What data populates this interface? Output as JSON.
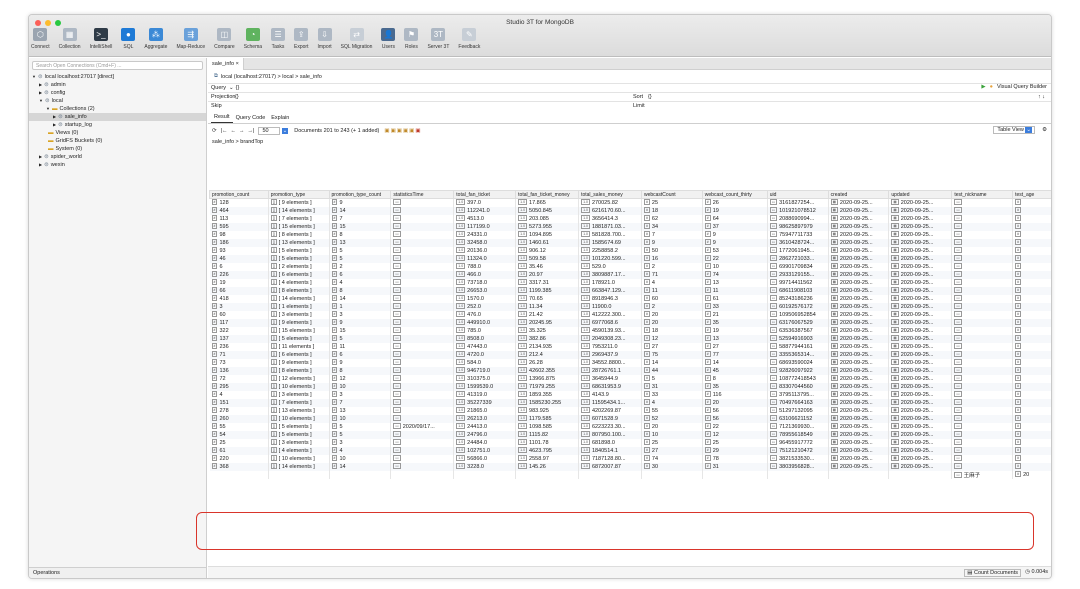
{
  "app": {
    "window_title": "Studio 3T for MongoDB",
    "toolbar": [
      {
        "label": "Connect",
        "icon": "connect-icon",
        "color": "#9aa4b0"
      },
      {
        "label": "Collection",
        "icon": "collection-icon",
        "color": "#aeb8c4"
      },
      {
        "label": "IntelliShell",
        "icon": "intellishell-icon",
        "color": "#2f3b47"
      },
      {
        "label": "SQL",
        "icon": "sql-icon",
        "color": "#1e7ad6"
      },
      {
        "label": "Aggregate",
        "icon": "aggregate-icon",
        "color": "#3b89d6"
      },
      {
        "label": "Map-Reduce",
        "icon": "map-reduce-icon",
        "color": "#6aa1da"
      },
      {
        "label": "Compare",
        "icon": "compare-icon",
        "color": "#aeb8c4"
      },
      {
        "label": "Schema",
        "icon": "schema-icon",
        "color": "#5fb35f"
      },
      {
        "label": "Tasks",
        "icon": "tasks-icon",
        "color": "#aeb8c4"
      },
      {
        "label": "Export",
        "icon": "export-icon",
        "color": "#aeb8c4"
      },
      {
        "label": "Import",
        "icon": "import-icon",
        "color": "#aeb8c4"
      },
      {
        "label": "SQL Migration",
        "icon": "sql-migration-icon",
        "color": "#c7ced6"
      },
      {
        "label": "Users",
        "icon": "users-icon",
        "color": "#4a6a90"
      },
      {
        "label": "Roles",
        "icon": "roles-icon",
        "color": "#aeb8c4"
      },
      {
        "label": "Server 3T",
        "icon": "server-icon",
        "color": "#aeb8c4"
      },
      {
        "label": "Feedback",
        "icon": "feedback-icon",
        "color": "#c7ced6"
      }
    ]
  },
  "sidebar": {
    "search_placeholder": "Search Open Connections (Cmd+F) ...",
    "tree": [
      {
        "label": "local localhost:27017 [direct]",
        "indent": 0,
        "arrow": "▼",
        "sel": false
      },
      {
        "label": "admin",
        "indent": 1,
        "arrow": "▶",
        "sel": false
      },
      {
        "label": "config",
        "indent": 1,
        "arrow": "▶",
        "sel": false
      },
      {
        "label": "local",
        "indent": 1,
        "arrow": "▼",
        "sel": false
      },
      {
        "label": "Collections (2)",
        "indent": 2,
        "arrow": "▼",
        "sel": false
      },
      {
        "label": "sale_info",
        "indent": 3,
        "arrow": "▶",
        "sel": true
      },
      {
        "label": "startup_log",
        "indent": 3,
        "arrow": "▶",
        "sel": false
      },
      {
        "label": "Views (0)",
        "indent": 2,
        "arrow": "",
        "sel": false
      },
      {
        "label": "GridFS Buckets (0)",
        "indent": 2,
        "arrow": "",
        "sel": false
      },
      {
        "label": "System (0)",
        "indent": 2,
        "arrow": "",
        "sel": false
      },
      {
        "label": "spider_world",
        "indent": 1,
        "arrow": "▶",
        "sel": false
      },
      {
        "label": "wexin",
        "indent": 1,
        "arrow": "▶",
        "sel": false
      }
    ],
    "operations_label": "Operations"
  },
  "editor": {
    "tab_label": "sale_info",
    "path": "local (localhost:27017)  >  local  >  sale_info",
    "query_label": "Query",
    "query_value": "{}",
    "projection_label": "Projection",
    "projection_value": "{}",
    "sort_label": "Sort",
    "sort_value": "{}",
    "skip_label": "Skip",
    "limit_label": "Limit",
    "visual_query_builder": "Visual Query Builder",
    "subtabs": [
      "Result",
      "Query Code",
      "Explain"
    ],
    "page_size": "50",
    "documents_info": "Documents 201 to 243 (+ 1 added)",
    "view_mode": "Table View",
    "breadcrumb": "sale_info > brandTop"
  },
  "grid": {
    "columns": [
      "promotion_count",
      "promotion_type",
      "promotion_type_count",
      "statisticsTime",
      "total_fan_ticket",
      "total_fan_ticket_money",
      "total_sales_money",
      "webcastCount",
      "webcast_count_thirty",
      "uid",
      "created",
      "updated",
      "test_nickname",
      "test_age"
    ],
    "rows": [
      [
        "128",
        "[ 9 elements ]",
        "9",
        "",
        "397.0",
        "17.865",
        "270025.82",
        "25",
        "26",
        "3161827254...",
        "2020-09-25...",
        "2020-09-25...",
        "",
        ""
      ],
      [
        "464",
        "[ 14 elements ]",
        "14",
        "",
        "112241.0",
        "5050.845",
        "6216170.60...",
        "18",
        "19",
        "101921078512",
        "2020-09-25...",
        "2020-09-25...",
        "",
        ""
      ],
      [
        "113",
        "[ 7 elements ]",
        "7",
        "",
        "4513.0",
        "203.085",
        "3656414.3",
        "62",
        "64",
        "2088690994...",
        "2020-09-25...",
        "2020-09-25...",
        "",
        ""
      ],
      [
        "595",
        "[ 15 elements ]",
        "15",
        "",
        "117199.0",
        "5273.955",
        "1881871.03...",
        "34",
        "37",
        "98625897979",
        "2020-09-25...",
        "2020-09-25...",
        "",
        ""
      ],
      [
        "98",
        "[ 8 elements ]",
        "8",
        "",
        "24331.0",
        "1094.895",
        "581828.700...",
        "7",
        "9",
        "75947711733",
        "2020-09-25...",
        "2020-09-25...",
        "",
        ""
      ],
      [
        "186",
        "[ 13 elements ]",
        "13",
        "",
        "32458.0",
        "1460.61",
        "1585674.69",
        "9",
        "9",
        "3610428724...",
        "2020-09-25...",
        "2020-09-25...",
        "",
        ""
      ],
      [
        "93",
        "[ 5 elements ]",
        "5",
        "",
        "20136.0",
        "906.12",
        "2258858.2",
        "50",
        "53",
        "1772061945...",
        "2020-09-25...",
        "2020-09-25...",
        "",
        ""
      ],
      [
        "46",
        "[ 5 elements ]",
        "5",
        "",
        "11324.0",
        "509.58",
        "101220.599...",
        "16",
        "22",
        "2862721033...",
        "2020-09-25...",
        "2020-09-25...",
        "",
        ""
      ],
      [
        "6",
        "[ 2 elements ]",
        "2",
        "",
        "788.0",
        "35.46",
        "529.0",
        "2",
        "10",
        "69901709834",
        "2020-09-25...",
        "2020-09-25...",
        "",
        ""
      ],
      [
        "226",
        "[ 6 elements ]",
        "6",
        "",
        "466.0",
        "20.97",
        "3809887.17...",
        "71",
        "74",
        "2933129155...",
        "2020-09-25...",
        "2020-09-25...",
        "",
        ""
      ],
      [
        "19",
        "[ 4 elements ]",
        "4",
        "",
        "73718.0",
        "3317.31",
        "178921.0",
        "4",
        "13",
        "99714411562",
        "2020-09-25...",
        "2020-09-25...",
        "",
        ""
      ],
      [
        "66",
        "[ 8 elements ]",
        "8",
        "",
        "26653.0",
        "1199.385",
        "663847.129...",
        "11",
        "11",
        "68611908103",
        "2020-09-25...",
        "2020-09-25...",
        "",
        ""
      ],
      [
        "418",
        "[ 14 elements ]",
        "14",
        "",
        "1570.0",
        "70.65",
        "8918946.3",
        "60",
        "61",
        "85243186236",
        "2020-09-25...",
        "2020-09-25...",
        "",
        ""
      ],
      [
        "3",
        "[ 1 elements ]",
        "1",
        "",
        "252.0",
        "11.34",
        "11900.0",
        "2",
        "33",
        "60192576172",
        "2020-09-25...",
        "2020-09-25...",
        "",
        ""
      ],
      [
        "60",
        "[ 3 elements ]",
        "3",
        "",
        "476.0",
        "21.42",
        "412222.300...",
        "20",
        "21",
        "109506952854",
        "2020-09-25...",
        "2020-09-25...",
        "",
        ""
      ],
      [
        "117",
        "[ 9 elements ]",
        "9",
        "",
        "449910.0",
        "20245.95",
        "6977068.6",
        "20",
        "35",
        "63176067529",
        "2020-09-25...",
        "2020-09-25...",
        "",
        ""
      ],
      [
        "322",
        "[ 15 elements ]",
        "15",
        "",
        "785.0",
        "35.325",
        "4590139.93...",
        "18",
        "19",
        "63536387567",
        "2020-09-25...",
        "2020-09-25...",
        "",
        ""
      ],
      [
        "137",
        "[ 5 elements ]",
        "5",
        "",
        "8508.0",
        "382.86",
        "2049308.23...",
        "12",
        "13",
        "52594916903",
        "2020-09-25...",
        "2020-09-25...",
        "",
        ""
      ],
      [
        "236",
        "[ 11 elements ]",
        "11",
        "",
        "47443.0",
        "2134.935",
        "7953211.0",
        "27",
        "27",
        "58877944161",
        "2020-09-25...",
        "2020-09-25...",
        "",
        ""
      ],
      [
        "71",
        "[ 6 elements ]",
        "6",
        "",
        "4720.0",
        "212.4",
        "2969437.9",
        "75",
        "77",
        "3355365314...",
        "2020-09-25...",
        "2020-09-25...",
        "",
        ""
      ],
      [
        "73",
        "[ 9 elements ]",
        "9",
        "",
        "584.0",
        "26.28",
        "34552.8800...",
        "14",
        "14",
        "68693590024",
        "2020-09-25...",
        "2020-09-25...",
        "",
        ""
      ],
      [
        "136",
        "[ 8 elements ]",
        "8",
        "",
        "946719.0",
        "42602.355",
        "28726761.1",
        "44",
        "45",
        "92826097922",
        "2020-09-25...",
        "2020-09-25...",
        "",
        ""
      ],
      [
        "72",
        "[ 12 elements ]",
        "12",
        "",
        "310375.0",
        "13966.875",
        "3645944.9",
        "5",
        "8",
        "108772418543",
        "2020-09-25...",
        "2020-09-25...",
        "",
        ""
      ],
      [
        "295",
        "[ 10 elements ]",
        "10",
        "",
        "1599539.0",
        "71979.255",
        "68631953.9",
        "31",
        "35",
        "83307044560",
        "2020-09-25...",
        "2020-09-25...",
        "",
        ""
      ],
      [
        "4",
        "[ 3 elements ]",
        "3",
        "",
        "41319.0",
        "1859.355",
        "4143.9",
        "33",
        "116",
        "3795113795...",
        "2020-09-25...",
        "2020-09-25...",
        "",
        ""
      ],
      [
        "151",
        "[ 7 elements ]",
        "7",
        "",
        "35227339",
        "1585230.255",
        "11595434.1...",
        "4",
        "20",
        "70497664163",
        "2020-09-25...",
        "2020-09-25...",
        "",
        ""
      ],
      [
        "278",
        "[ 13 elements ]",
        "13",
        "",
        "21865.0",
        "983.925",
        "4202269.87",
        "55",
        "56",
        "51297132095",
        "2020-09-25...",
        "2020-09-25...",
        "",
        ""
      ],
      [
        "260",
        "[ 10 elements ]",
        "10",
        "",
        "26213.0",
        "1179.585",
        "6071528.9",
        "52",
        "56",
        "63106621152",
        "2020-09-25...",
        "2020-09-25...",
        "",
        ""
      ],
      [
        "55",
        "[ 5 elements ]",
        "5",
        "2020/09/17...",
        "24413.0",
        "1098.585",
        "6223223.30...",
        "20",
        "22",
        "7121369930...",
        "2020-09-25...",
        "2020-09-25...",
        "",
        ""
      ],
      [
        "54",
        "[ 5 elements ]",
        "5",
        "",
        "24796.0",
        "1115.82",
        "807950.100...",
        "10",
        "12",
        "78955618549",
        "2020-09-25...",
        "2020-09-25...",
        "",
        ""
      ],
      [
        "25",
        "[ 3 elements ]",
        "3",
        "",
        "24484.0",
        "1101.78",
        "681898.0",
        "25",
        "25",
        "96455917772",
        "2020-09-25...",
        "2020-09-25...",
        "",
        ""
      ],
      [
        "61",
        "[ 4 elements ]",
        "4",
        "",
        "102751.0",
        "4623.795",
        "1840514.1",
        "27",
        "29",
        "75121210472",
        "2020-09-25...",
        "2020-09-25...",
        "",
        ""
      ],
      [
        "220",
        "[ 10 elements ]",
        "10",
        "",
        "56866.0",
        "2558.97",
        "7187128.80...",
        "74",
        "78",
        "3821533530...",
        "2020-09-25...",
        "2020-09-25...",
        "",
        ""
      ],
      [
        "368",
        "[ 14 elements ]",
        "14",
        "",
        "3228.0",
        "145.26",
        "6872007.87",
        "30",
        "31",
        "3803956828...",
        "2020-09-25...",
        "2020-09-25...",
        "",
        ""
      ],
      [
        "",
        "",
        "",
        "",
        "",
        "",
        "",
        "",
        "",
        "",
        "",
        "",
        "王麻子",
        "20"
      ]
    ]
  },
  "status": {
    "count_documents": "Count Documents",
    "elapsed": "0.004s"
  }
}
